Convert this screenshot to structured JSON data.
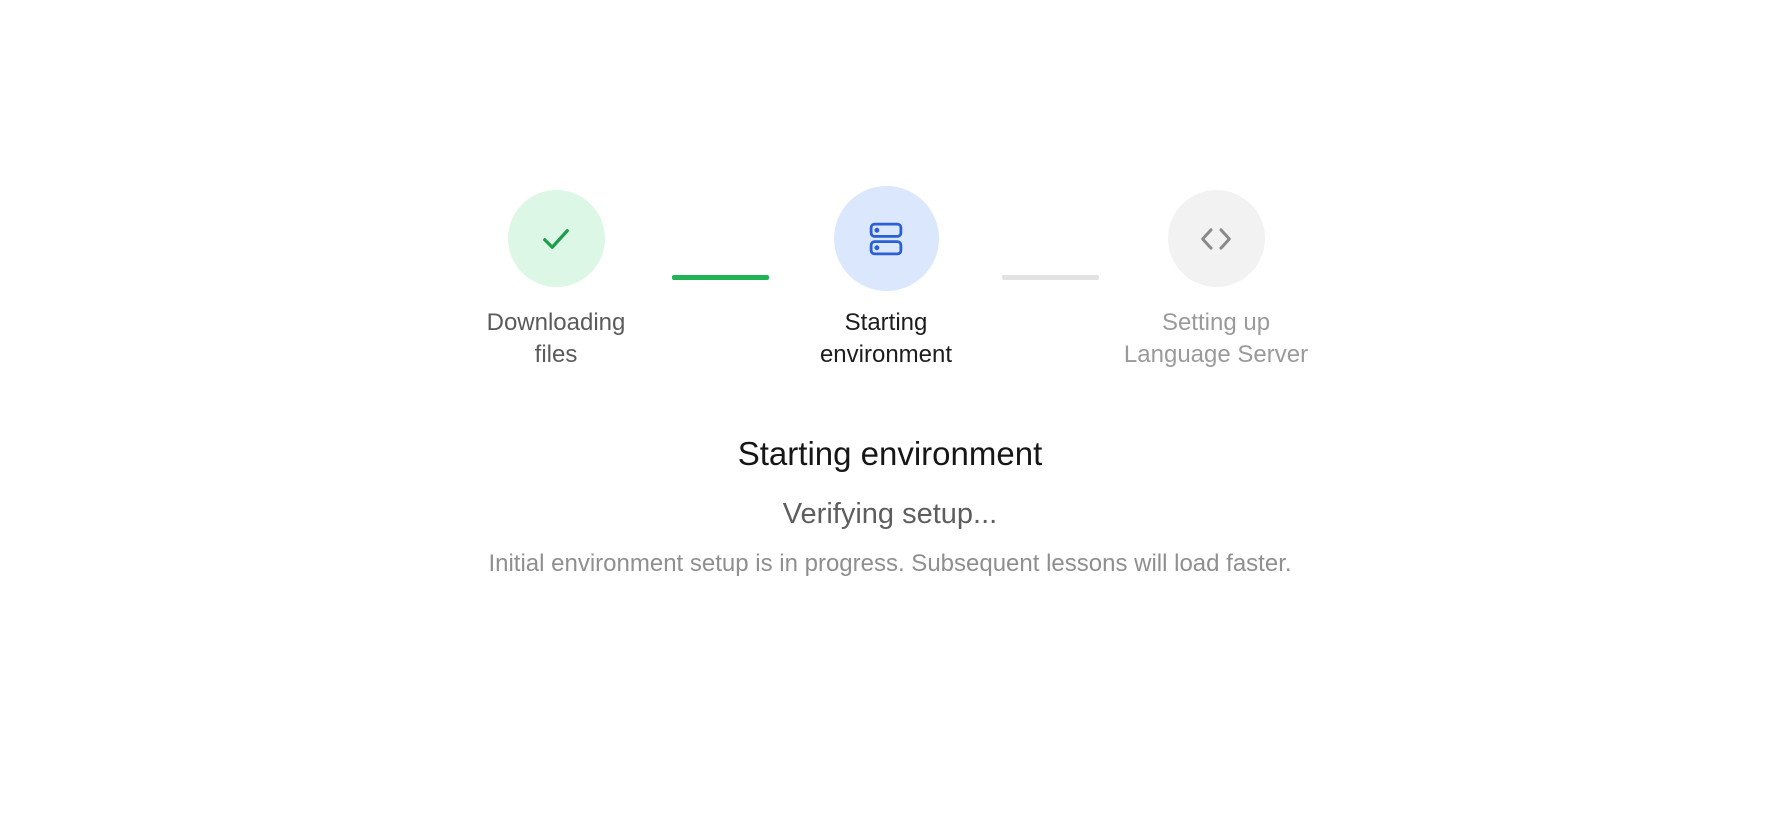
{
  "steps": [
    {
      "label_line1": "Downloading",
      "label_line2": "files",
      "state": "complete",
      "icon": "check-icon",
      "icon_color": "#1f9d4c",
      "circle_color": "#dcf7e6"
    },
    {
      "label_line1": "Starting",
      "label_line2": "environment",
      "state": "active",
      "icon": "server-icon",
      "icon_color": "#2a5fd6",
      "circle_color": "#dbe7fd"
    },
    {
      "label_line1": "Setting up",
      "label_line2": "Language Server",
      "state": "pending",
      "icon": "code-icon",
      "icon_color": "#8a8a8a",
      "circle_color": "#f2f2f2"
    }
  ],
  "connectors": [
    {
      "state": "complete",
      "color": "#22b357"
    },
    {
      "state": "pending",
      "color": "#e2e2e2"
    }
  ],
  "status": {
    "title": "Starting environment",
    "subtitle": "Verifying setup...",
    "note": "Initial environment setup is in progress. Subsequent lessons will load faster."
  }
}
